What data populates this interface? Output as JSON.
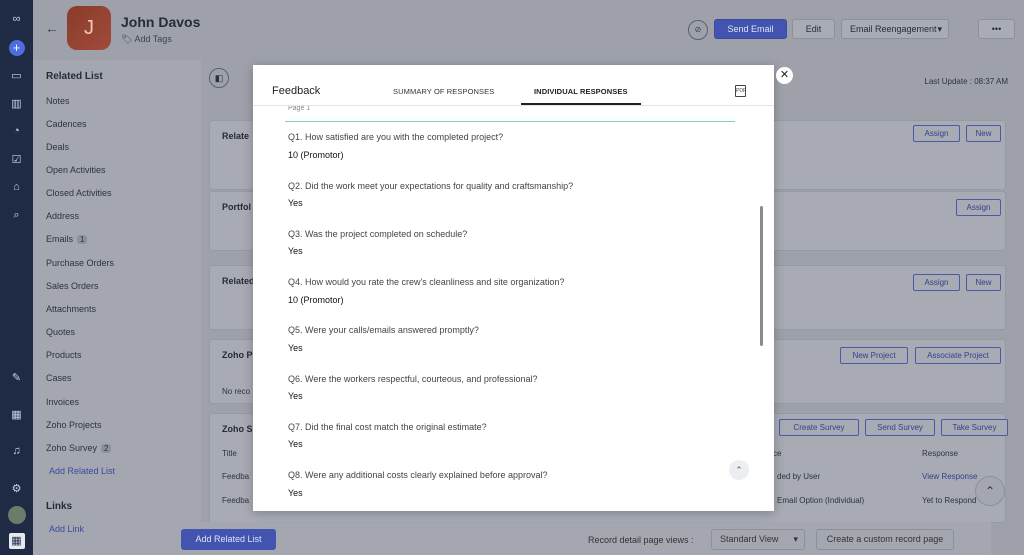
{
  "contact": {
    "initial": "J",
    "name": "John Davos",
    "add_tags": "Add Tags"
  },
  "header_buttons": {
    "send_email": "Send Email",
    "edit": "Edit",
    "email_reengagement": "Email Reengagement",
    "more": "•••"
  },
  "sidebar": {
    "heading": "Related List",
    "items": [
      {
        "label": "Notes",
        "count": ""
      },
      {
        "label": "Cadences",
        "count": ""
      },
      {
        "label": "Deals",
        "count": ""
      },
      {
        "label": "Open Activities",
        "count": ""
      },
      {
        "label": "Closed Activities",
        "count": ""
      },
      {
        "label": "Address",
        "count": ""
      },
      {
        "label": "Emails",
        "count": "1"
      },
      {
        "label": "Purchase Orders",
        "count": ""
      },
      {
        "label": "Sales Orders",
        "count": ""
      },
      {
        "label": "Attachments",
        "count": ""
      },
      {
        "label": "Quotes",
        "count": ""
      },
      {
        "label": "Products",
        "count": ""
      },
      {
        "label": "Cases",
        "count": ""
      },
      {
        "label": "Invoices",
        "count": ""
      },
      {
        "label": "Zoho Projects",
        "count": ""
      },
      {
        "label": "Zoho Survey",
        "count": "2"
      }
    ],
    "add_related_list": "Add Related List",
    "links_heading": "Links",
    "add_link": "Add Link"
  },
  "content": {
    "last_update": "Last Update : 08:37 AM",
    "cards": [
      {
        "title": "Relate",
        "buttons": [
          "Assign",
          "New"
        ]
      },
      {
        "title": "Portfol",
        "buttons": [
          "Assign"
        ]
      },
      {
        "title": "Related",
        "buttons": [
          "Assign",
          "New"
        ]
      },
      {
        "title": "Zoho P",
        "buttons": [
          "New Project",
          "Associate Project"
        ],
        "empty_text": "No reco"
      },
      {
        "title": "Zoho S",
        "buttons": [
          "Create Survey",
          "Send Survey",
          "Take Survey"
        ]
      }
    ],
    "survey_table": {
      "headers": [
        "Title",
        "ce",
        "Response"
      ],
      "rows": [
        [
          "Feedba",
          "ded by User",
          "View Response"
        ],
        [
          "Feedba",
          "Email Option (Individual)",
          "Yet to Respond"
        ]
      ]
    }
  },
  "footer": {
    "add_related_list": "Add Related List",
    "record_detail_label": "Record detail page views :",
    "view_select": "Standard View",
    "create_custom": "Create a custom record page"
  },
  "modal": {
    "title": "Feedback",
    "tabs": [
      "SUMMARY OF RESPONSES",
      "INDIVIDUAL RESPONSES"
    ],
    "active_tab": "INDIVIDUAL RESPONSES",
    "page_label": "Page 1",
    "questions": [
      {
        "q": "Q1. How satisfied are you with the completed project?",
        "a": "10 (Promotor)"
      },
      {
        "q": "Q2. Did the work meet your expectations for quality and craftsmanship?",
        "a": "Yes"
      },
      {
        "q": "Q3. Was the project completed on schedule?",
        "a": "Yes"
      },
      {
        "q": "Q4. How would you rate the crew's cleanliness and site organization?",
        "a": "10 (Promotor)"
      },
      {
        "q": "Q5. Were your calls/emails answered promptly?",
        "a": "Yes"
      },
      {
        "q": "Q6. Were the workers respectful, courteous, and professional?",
        "a": "Yes"
      },
      {
        "q": "Q7. Did the final cost match the original estimate?",
        "a": "Yes"
      },
      {
        "q": "Q8. Were any additional costs clearly explained before approval?",
        "a": "Yes"
      }
    ]
  },
  "colors": {
    "rail": "#1f2a44",
    "primary": "#4254b0",
    "teal_line": "#7fd0bd",
    "overlay": "#9ea1aa"
  }
}
